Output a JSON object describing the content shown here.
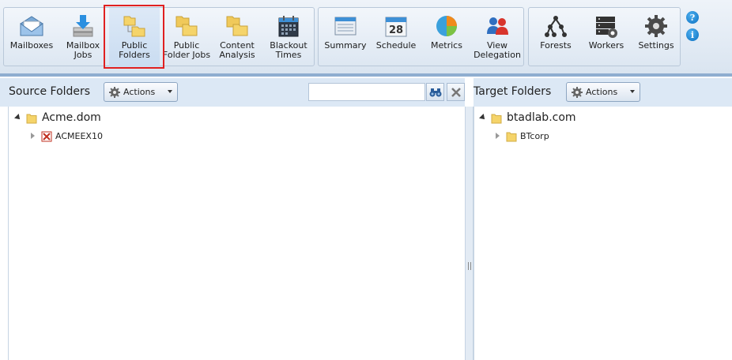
{
  "ribbon": {
    "buttons": [
      {
        "id": "mailboxes",
        "label_lines": [
          "Mailboxes"
        ]
      },
      {
        "id": "mailbox_jobs",
        "label_lines": [
          "Mailbox",
          "Jobs"
        ]
      },
      {
        "id": "public_folders",
        "label_lines": [
          "Public",
          "Folders"
        ],
        "selected": true
      },
      {
        "id": "public_folder_jobs",
        "label_lines": [
          "Public",
          "Folder Jobs"
        ]
      },
      {
        "id": "content_analysis",
        "label_lines": [
          "Content",
          "Analysis"
        ]
      },
      {
        "id": "blackout_times",
        "label_lines": [
          "Blackout",
          "Times"
        ]
      },
      {
        "id": "summary",
        "label_lines": [
          "Summary"
        ]
      },
      {
        "id": "schedule",
        "label_lines": [
          "Schedule"
        ],
        "icon_text": "28"
      },
      {
        "id": "metrics",
        "label_lines": [
          "Metrics"
        ]
      },
      {
        "id": "view_delegation",
        "label_lines": [
          "View",
          "Delegation"
        ]
      },
      {
        "id": "forests",
        "label_lines": [
          "Forests"
        ]
      },
      {
        "id": "workers",
        "label_lines": [
          "Workers"
        ]
      },
      {
        "id": "settings",
        "label_lines": [
          "Settings"
        ]
      }
    ],
    "help_glyph": "?",
    "info_glyph": "i"
  },
  "source": {
    "title": "Source Folders",
    "actions_label": "Actions",
    "search_value": "",
    "tree": {
      "root": "Acme.dom",
      "children": [
        "ACMEEX10"
      ]
    }
  },
  "target": {
    "title": "Target Folders",
    "actions_label": "Actions",
    "tree": {
      "root": "btadlab.com",
      "children": [
        "BTcorp"
      ]
    }
  },
  "colors": {
    "selection_frame": "#e02020",
    "header_bg": "#dce8f5",
    "folder": "#f5d46a"
  }
}
